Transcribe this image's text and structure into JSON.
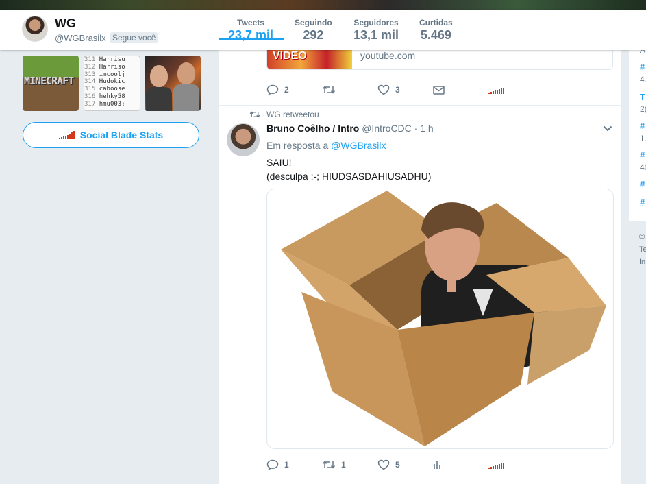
{
  "profile": {
    "name": "WG",
    "handle": "@WGBrasilx",
    "follows_you": "Segue você"
  },
  "stats": [
    {
      "label": "Tweets",
      "value": "23,7 mil",
      "active": true
    },
    {
      "label": "Seguindo",
      "value": "292",
      "active": false
    },
    {
      "label": "Seguidores",
      "value": "13,1 mil",
      "active": false
    },
    {
      "label": "Curtidas",
      "value": "5.469",
      "active": false
    }
  ],
  "media": {
    "minecraft_text": "MINECRAFT",
    "list_lines": [
      {
        "num": "311",
        "text": "Harrisu"
      },
      {
        "num": "312",
        "text": "Harriso"
      },
      {
        "num": "313",
        "text": "imcoolj"
      },
      {
        "num": "314",
        "text": "Hudokic"
      },
      {
        "num": "315",
        "text": "caboose"
      },
      {
        "num": "316",
        "text": "hehky58"
      },
      {
        "num": "317",
        "text": "hmu003:"
      }
    ]
  },
  "social_blade": {
    "label": "Social Blade Stats",
    "color": "#d2391c"
  },
  "previous_tweet": {
    "card_thumb_text": "VIDEO",
    "card_url": "youtube.com",
    "replies": "2",
    "retweets": "",
    "likes": "3"
  },
  "tweet": {
    "retweet_label": "WG retweetou",
    "author_name": "Bruno Coêlho / Intro",
    "author_handle": "@IntroCDC",
    "time": "· 1 h",
    "reply_prefix": "Em resposta a",
    "reply_handle": "@WGBrasilx",
    "text_line1": "SAIU!",
    "text_line2": "(desculpa ;-; HIUDSASDAHIUSADHU)",
    "replies": "1",
    "retweets": "1",
    "likes": "5"
  },
  "right_column": {
    "trends": [
      "A",
      "#",
      "4.",
      "T",
      "2(",
      "#",
      "1.",
      "#",
      "40",
      "#",
      "#"
    ],
    "footer": [
      "©",
      "Te",
      "In"
    ]
  },
  "colors": {
    "accent": "#1da1f2",
    "muted": "#657786",
    "background": "#e6ecf0"
  }
}
